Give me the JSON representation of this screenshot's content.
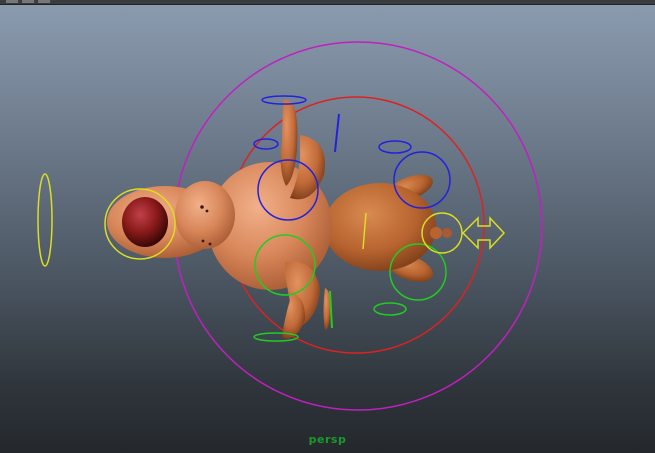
{
  "viewport": {
    "camera_label": "persp",
    "background_top": "#8c9cb0",
    "background_bottom": "#24282d"
  },
  "scene": {
    "object": "cartoon-dog-model",
    "controls": [
      "master-control-circle",
      "cog-control-circle",
      "head-control-circle",
      "tail-control-circle",
      "front-left-leg-control",
      "front-right-leg-control",
      "back-left-leg-control",
      "back-right-leg-control",
      "move-arrow-control"
    ],
    "colors": {
      "master_control": "#c020c0",
      "cog_control": "#dd2222",
      "left_controls": "#2222dd",
      "right_controls": "#22cc22",
      "center_controls": "#dddd22",
      "skin": "#d8875a",
      "nose": "#8a1a1a"
    }
  }
}
